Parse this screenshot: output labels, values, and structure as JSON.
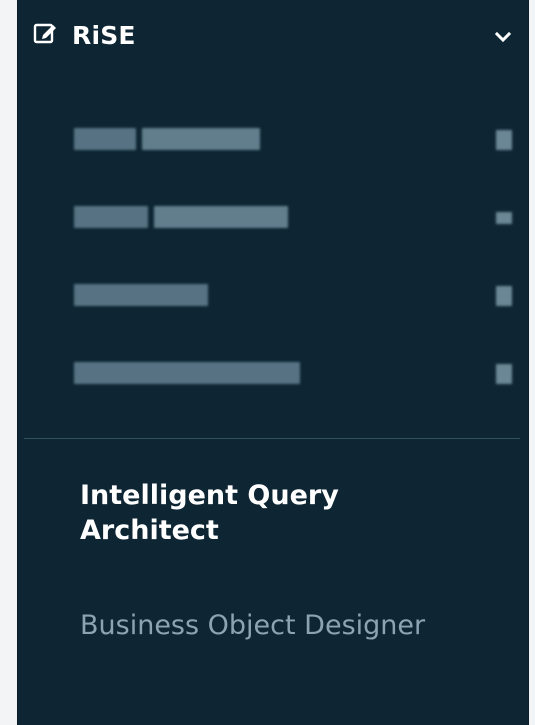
{
  "header": {
    "icon": "edit-square-icon",
    "title": "RiSE",
    "chevron": "chevron-down-icon"
  },
  "menu": {
    "redacted_items": [
      {
        "label": ""
      },
      {
        "label": ""
      },
      {
        "label": ""
      },
      {
        "label": ""
      }
    ],
    "active_item": {
      "label": "Intelligent Query Architect"
    },
    "inactive_item": {
      "label": "Business Object Designer"
    }
  },
  "colors": {
    "panel_background": "#0e2634",
    "active_text": "#ffffff",
    "inactive_text": "#8ba3b2",
    "divider": "#32505f"
  }
}
